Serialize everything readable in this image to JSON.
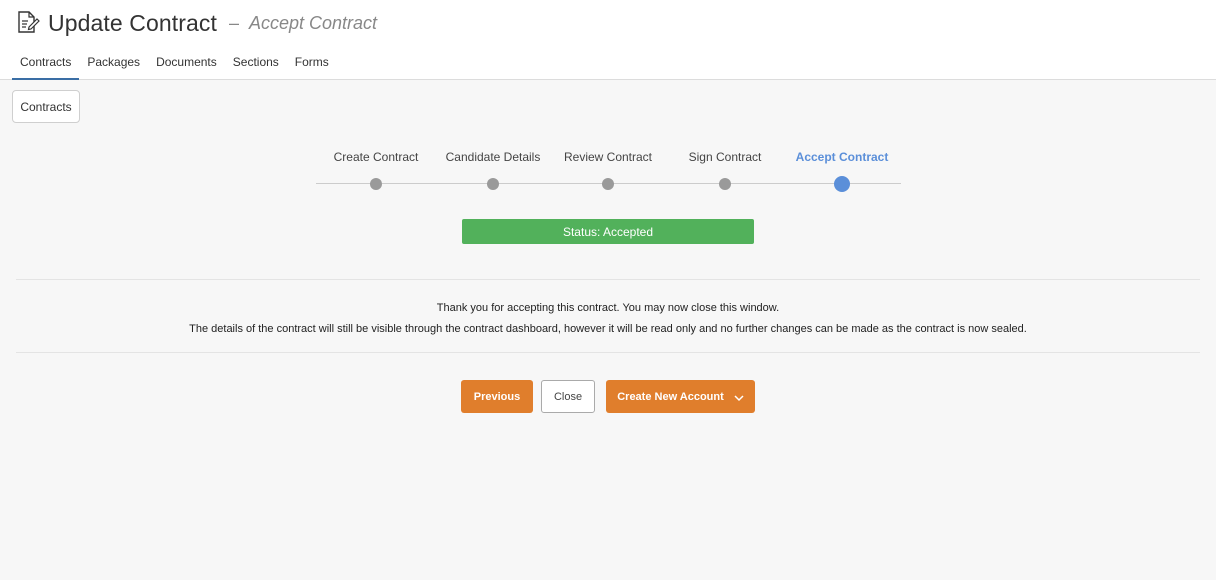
{
  "header": {
    "title": "Update Contract",
    "separator": "–",
    "subtitle": "Accept Contract",
    "tabs": [
      {
        "label": "Contracts",
        "active": true
      },
      {
        "label": "Packages",
        "active": false
      },
      {
        "label": "Documents",
        "active": false
      },
      {
        "label": "Sections",
        "active": false
      },
      {
        "label": "Forms",
        "active": false
      }
    ]
  },
  "breadcrumb": {
    "button_label": "Contracts"
  },
  "stepper": {
    "steps": [
      {
        "label": "Create Contract",
        "active": false
      },
      {
        "label": "Candidate Details",
        "active": false
      },
      {
        "label": "Review Contract",
        "active": false
      },
      {
        "label": "Sign Contract",
        "active": false
      },
      {
        "label": "Accept Contract",
        "active": true
      }
    ]
  },
  "status": {
    "text": "Status: Accepted",
    "color": "#52b15b"
  },
  "message": {
    "line1": "Thank you for accepting this contract. You may now close this window.",
    "line2": "The details of the contract will still be visible through the contract dashboard, however it will be read only and no further changes can be made as the contract is now sealed."
  },
  "actions": {
    "previous_label": "Previous",
    "close_label": "Close",
    "create_label": "Create New Account"
  },
  "colors": {
    "accent_orange": "#e07e2c",
    "active_step_blue": "#5b8fd9",
    "inactive_dot": "#9a9a9a"
  },
  "icons": {
    "title_icon": "document-edit-icon",
    "create_dropdown_icon": "chevron-down-icon"
  }
}
